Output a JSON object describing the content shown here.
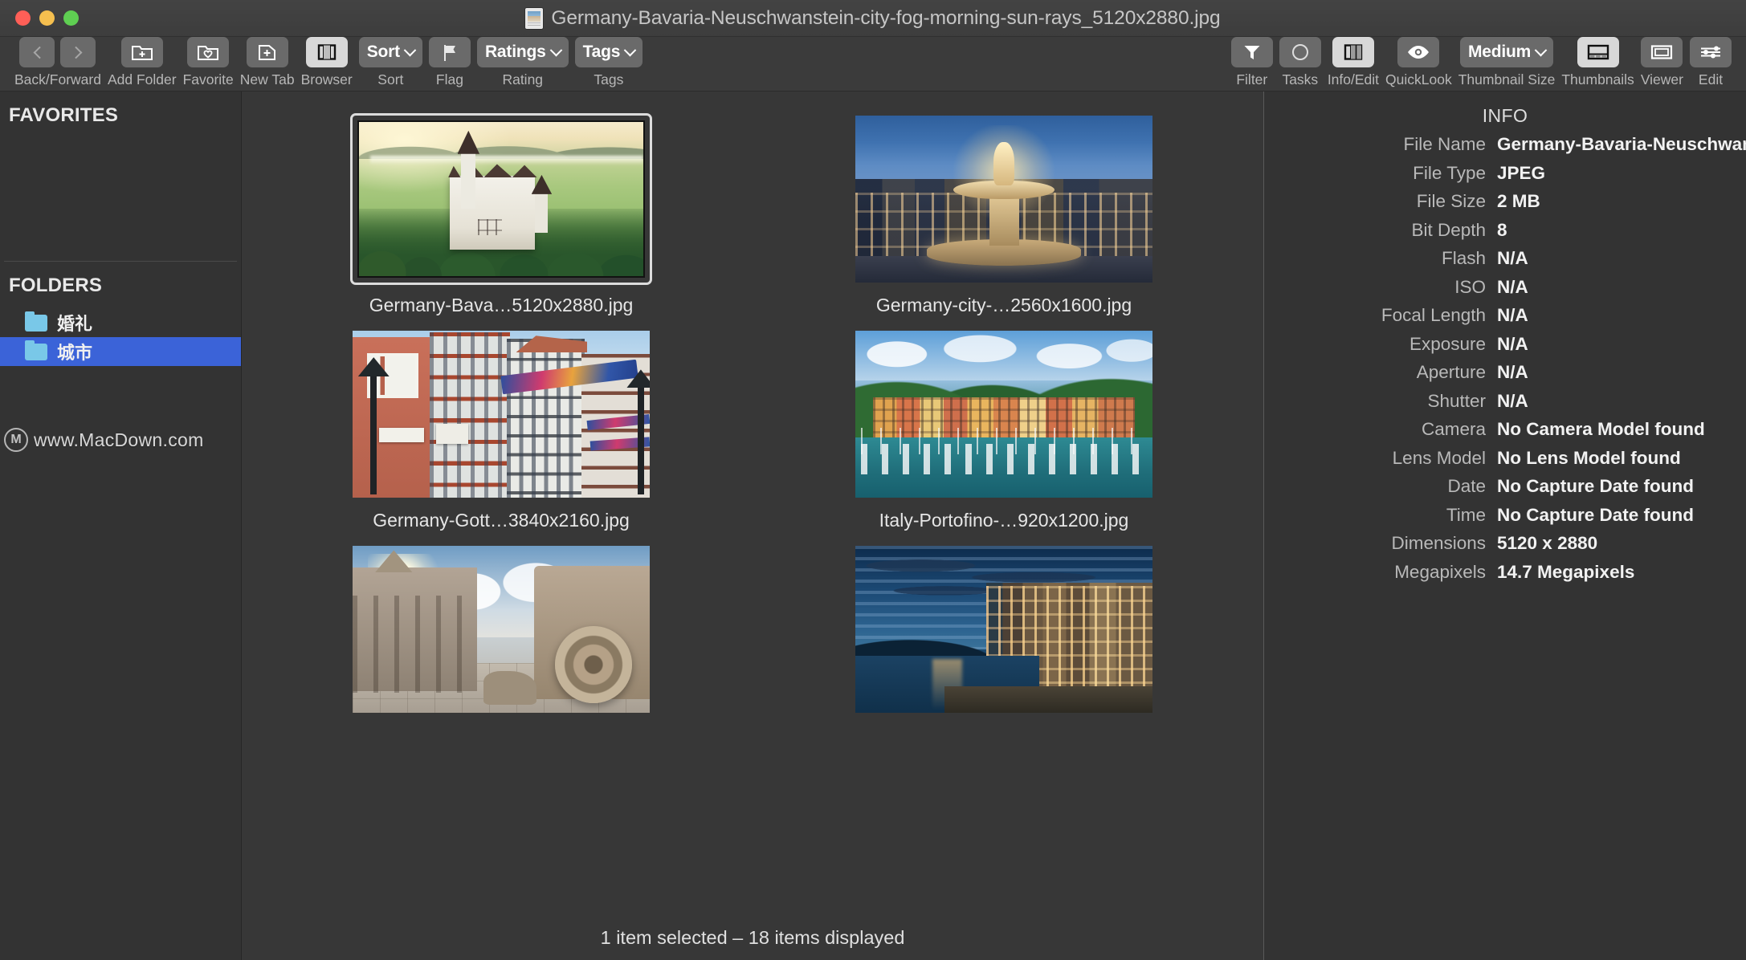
{
  "window": {
    "title": "Germany-Bavaria-Neuschwanstein-city-fog-morning-sun-rays_5120x2880.jpg"
  },
  "toolbar": {
    "items": [
      {
        "label": "Back/Forward",
        "icon": "back-forward-arrows",
        "type": "nav-pair"
      },
      {
        "label": "Add Folder",
        "icon": "folder-plus-icon",
        "type": "icon"
      },
      {
        "label": "Favorite",
        "icon": "folder-heart-icon",
        "type": "icon"
      },
      {
        "label": "New Tab",
        "icon": "tab-plus-icon",
        "type": "icon"
      },
      {
        "label": "Browser",
        "icon": "browser-columns-icon",
        "type": "icon",
        "active": true
      },
      {
        "label": "Sort",
        "icon": "chevron-down-icon",
        "type": "dropdown",
        "value": "Sort"
      },
      {
        "label": "Flag",
        "icon": "flag-icon",
        "type": "icon"
      },
      {
        "label": "Rating",
        "icon": "chevron-down-icon",
        "type": "dropdown",
        "value": "Ratings"
      },
      {
        "label": "Tags",
        "icon": "chevron-down-icon",
        "type": "dropdown",
        "value": "Tags"
      },
      {
        "label": "Filter",
        "icon": "funnel-icon",
        "type": "icon"
      },
      {
        "label": "Tasks",
        "icon": "circle-icon",
        "type": "icon"
      },
      {
        "label": "Info/Edit",
        "icon": "panel-split-icon",
        "type": "icon",
        "active": true
      },
      {
        "label": "QuickLook",
        "icon": "eye-icon",
        "type": "icon"
      },
      {
        "label": "Thumbnail Size",
        "icon": "chevron-down-icon",
        "type": "dropdown",
        "value": "Medium"
      },
      {
        "label": "Thumbnails",
        "icon": "thumbnails-grid-icon",
        "type": "icon",
        "active": true
      },
      {
        "label": "Viewer",
        "icon": "viewer-frame-icon",
        "type": "icon"
      },
      {
        "label": "Edit",
        "icon": "sliders-icon",
        "type": "icon"
      }
    ]
  },
  "sidebar": {
    "favorites_header": "FAVORITES",
    "favorites_items": [],
    "folders_header": "FOLDERS",
    "folders_items": [
      {
        "label": "婚礼",
        "icon": "folder-icon",
        "selected": false
      },
      {
        "label": "城市",
        "icon": "folder-icon",
        "selected": true
      }
    ],
    "watermark": {
      "logo": "macdown-logo-icon",
      "text": "www.MacDown.com"
    }
  },
  "browser": {
    "thumbnails": [
      {
        "caption": "Germany-Bava…5120x2880.jpg",
        "art": "art-castle",
        "selected": true
      },
      {
        "caption": "Germany-city-…2560x1600.jpg",
        "art": "art-fountain",
        "selected": false
      },
      {
        "caption": "Germany-Gott…3840x2160.jpg",
        "art": "art-street",
        "selected": false
      },
      {
        "caption": "Italy-Portofino-…920x1200.jpg",
        "art": "art-porto",
        "selected": false
      },
      {
        "caption": "",
        "art": "art-temple",
        "selected": false
      },
      {
        "caption": "",
        "art": "art-camogli",
        "selected": false
      }
    ],
    "status": "1 item selected – 18 items displayed"
  },
  "info": {
    "title": "INFO",
    "rows": [
      {
        "key": "File Name",
        "value": "Germany-Bavaria-Neuschwan…"
      },
      {
        "key": "File Type",
        "value": "JPEG"
      },
      {
        "key": "File Size",
        "value": "2 MB"
      },
      {
        "key": "Bit Depth",
        "value": "8"
      },
      {
        "key": "Flash",
        "value": "N/A"
      },
      {
        "key": "ISO",
        "value": "N/A"
      },
      {
        "key": "Focal Length",
        "value": "N/A"
      },
      {
        "key": "Exposure",
        "value": "N/A"
      },
      {
        "key": "Aperture",
        "value": "N/A"
      },
      {
        "key": "Shutter",
        "value": "N/A"
      },
      {
        "key": "Camera",
        "value": "No Camera Model found"
      },
      {
        "key": "Lens Model",
        "value": "No Lens Model found"
      },
      {
        "key": "Date",
        "value": "No Capture Date found"
      },
      {
        "key": "Time",
        "value": "No Capture Date found"
      },
      {
        "key": "Dimensions",
        "value": "5120 x 2880"
      },
      {
        "key": "Megapixels",
        "value": "14.7 Megapixels"
      }
    ]
  },
  "colors": {
    "window_bg": "#383838",
    "sidebar_bg": "#333333",
    "browser_bg": "#373737",
    "selection_blue": "#3b63d8",
    "toolbar_btn": "#6a6a6a",
    "toolbar_btn_active": "#d8d8d8",
    "close_red": "#ff5f57",
    "minimize_yellow": "#f5bf4f",
    "zoom_green": "#5fcf52"
  }
}
